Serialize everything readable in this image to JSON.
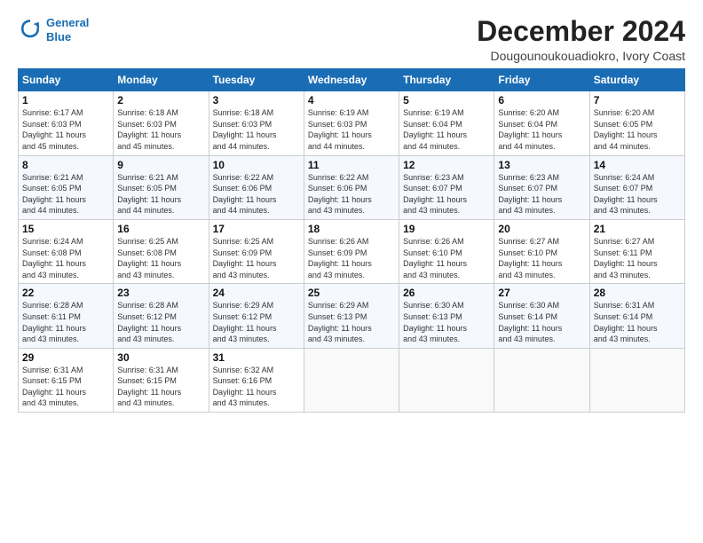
{
  "logo": {
    "line1": "General",
    "line2": "Blue"
  },
  "title": "December 2024",
  "location": "Dougounoukouadiokro, Ivory Coast",
  "weekdays": [
    "Sunday",
    "Monday",
    "Tuesday",
    "Wednesday",
    "Thursday",
    "Friday",
    "Saturday"
  ],
  "weeks": [
    [
      {
        "day": "1",
        "info": "Sunrise: 6:17 AM\nSunset: 6:03 PM\nDaylight: 11 hours\nand 45 minutes."
      },
      {
        "day": "2",
        "info": "Sunrise: 6:18 AM\nSunset: 6:03 PM\nDaylight: 11 hours\nand 45 minutes."
      },
      {
        "day": "3",
        "info": "Sunrise: 6:18 AM\nSunset: 6:03 PM\nDaylight: 11 hours\nand 44 minutes."
      },
      {
        "day": "4",
        "info": "Sunrise: 6:19 AM\nSunset: 6:03 PM\nDaylight: 11 hours\nand 44 minutes."
      },
      {
        "day": "5",
        "info": "Sunrise: 6:19 AM\nSunset: 6:04 PM\nDaylight: 11 hours\nand 44 minutes."
      },
      {
        "day": "6",
        "info": "Sunrise: 6:20 AM\nSunset: 6:04 PM\nDaylight: 11 hours\nand 44 minutes."
      },
      {
        "day": "7",
        "info": "Sunrise: 6:20 AM\nSunset: 6:05 PM\nDaylight: 11 hours\nand 44 minutes."
      }
    ],
    [
      {
        "day": "8",
        "info": "Sunrise: 6:21 AM\nSunset: 6:05 PM\nDaylight: 11 hours\nand 44 minutes."
      },
      {
        "day": "9",
        "info": "Sunrise: 6:21 AM\nSunset: 6:05 PM\nDaylight: 11 hours\nand 44 minutes."
      },
      {
        "day": "10",
        "info": "Sunrise: 6:22 AM\nSunset: 6:06 PM\nDaylight: 11 hours\nand 44 minutes."
      },
      {
        "day": "11",
        "info": "Sunrise: 6:22 AM\nSunset: 6:06 PM\nDaylight: 11 hours\nand 43 minutes."
      },
      {
        "day": "12",
        "info": "Sunrise: 6:23 AM\nSunset: 6:07 PM\nDaylight: 11 hours\nand 43 minutes."
      },
      {
        "day": "13",
        "info": "Sunrise: 6:23 AM\nSunset: 6:07 PM\nDaylight: 11 hours\nand 43 minutes."
      },
      {
        "day": "14",
        "info": "Sunrise: 6:24 AM\nSunset: 6:07 PM\nDaylight: 11 hours\nand 43 minutes."
      }
    ],
    [
      {
        "day": "15",
        "info": "Sunrise: 6:24 AM\nSunset: 6:08 PM\nDaylight: 11 hours\nand 43 minutes."
      },
      {
        "day": "16",
        "info": "Sunrise: 6:25 AM\nSunset: 6:08 PM\nDaylight: 11 hours\nand 43 minutes."
      },
      {
        "day": "17",
        "info": "Sunrise: 6:25 AM\nSunset: 6:09 PM\nDaylight: 11 hours\nand 43 minutes."
      },
      {
        "day": "18",
        "info": "Sunrise: 6:26 AM\nSunset: 6:09 PM\nDaylight: 11 hours\nand 43 minutes."
      },
      {
        "day": "19",
        "info": "Sunrise: 6:26 AM\nSunset: 6:10 PM\nDaylight: 11 hours\nand 43 minutes."
      },
      {
        "day": "20",
        "info": "Sunrise: 6:27 AM\nSunset: 6:10 PM\nDaylight: 11 hours\nand 43 minutes."
      },
      {
        "day": "21",
        "info": "Sunrise: 6:27 AM\nSunset: 6:11 PM\nDaylight: 11 hours\nand 43 minutes."
      }
    ],
    [
      {
        "day": "22",
        "info": "Sunrise: 6:28 AM\nSunset: 6:11 PM\nDaylight: 11 hours\nand 43 minutes."
      },
      {
        "day": "23",
        "info": "Sunrise: 6:28 AM\nSunset: 6:12 PM\nDaylight: 11 hours\nand 43 minutes."
      },
      {
        "day": "24",
        "info": "Sunrise: 6:29 AM\nSunset: 6:12 PM\nDaylight: 11 hours\nand 43 minutes."
      },
      {
        "day": "25",
        "info": "Sunrise: 6:29 AM\nSunset: 6:13 PM\nDaylight: 11 hours\nand 43 minutes."
      },
      {
        "day": "26",
        "info": "Sunrise: 6:30 AM\nSunset: 6:13 PM\nDaylight: 11 hours\nand 43 minutes."
      },
      {
        "day": "27",
        "info": "Sunrise: 6:30 AM\nSunset: 6:14 PM\nDaylight: 11 hours\nand 43 minutes."
      },
      {
        "day": "28",
        "info": "Sunrise: 6:31 AM\nSunset: 6:14 PM\nDaylight: 11 hours\nand 43 minutes."
      }
    ],
    [
      {
        "day": "29",
        "info": "Sunrise: 6:31 AM\nSunset: 6:15 PM\nDaylight: 11 hours\nand 43 minutes."
      },
      {
        "day": "30",
        "info": "Sunrise: 6:31 AM\nSunset: 6:15 PM\nDaylight: 11 hours\nand 43 minutes."
      },
      {
        "day": "31",
        "info": "Sunrise: 6:32 AM\nSunset: 6:16 PM\nDaylight: 11 hours\nand 43 minutes."
      },
      {
        "day": "",
        "info": ""
      },
      {
        "day": "",
        "info": ""
      },
      {
        "day": "",
        "info": ""
      },
      {
        "day": "",
        "info": ""
      }
    ]
  ]
}
